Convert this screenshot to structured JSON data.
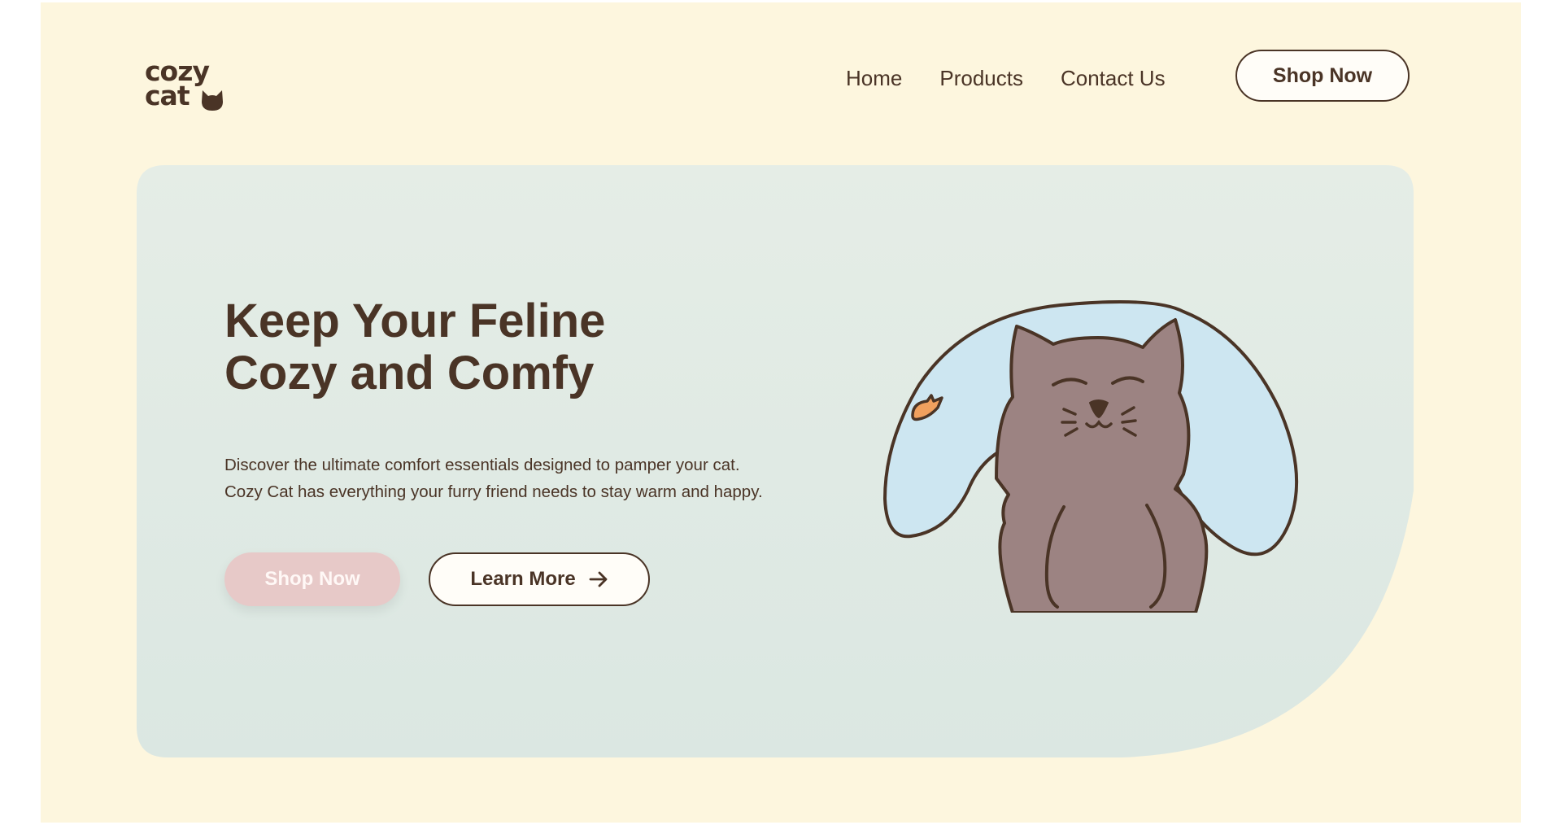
{
  "brand": {
    "logo_line1": "cozy",
    "logo_line2": "cat",
    "logo_icon": "cat-head-icon"
  },
  "nav": {
    "items": [
      {
        "label": "Home"
      },
      {
        "label": "Products"
      },
      {
        "label": "Contact Us"
      }
    ],
    "cta_label": "Shop Now"
  },
  "hero": {
    "title_line1": "Keep Your Feline",
    "title_line2": "Cozy and Comfy",
    "description_line1": "Discover the ultimate comfort essentials designed to pamper your cat.",
    "description_line2": "Cozy Cat has everything your furry friend needs to stay warm and happy.",
    "primary_button": "Shop Now",
    "secondary_button": "Learn More",
    "secondary_icon": "arrow-right-icon",
    "illustration": "cat-on-pillow-illustration"
  },
  "colors": {
    "page_bg": "#fdf6de",
    "hero_bg": "#e1ebe5",
    "text": "#4a3426",
    "primary_button": "#e7c9c8",
    "pillow": "#cde6f1",
    "cat": "#9c8382",
    "fish": "#f0a05e"
  }
}
